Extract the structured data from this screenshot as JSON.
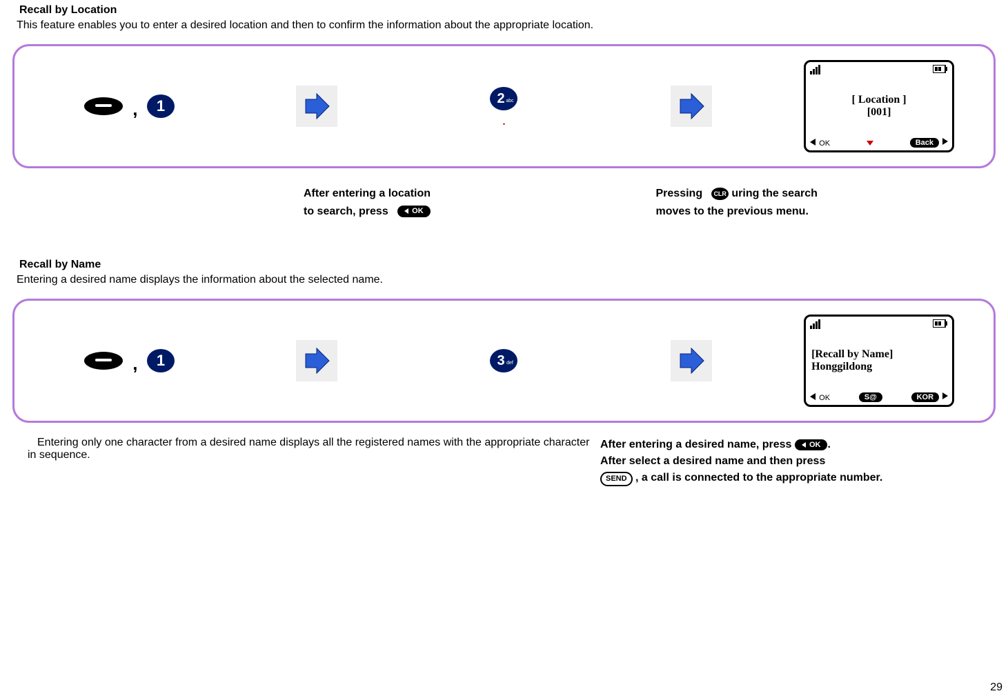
{
  "page_number": "29",
  "section1": {
    "title": "Recall by Location",
    "desc": "This feature enables you to enter a desired location and then to confirm the information about the appropriate location.",
    "key1_label": "1",
    "key2_label": "2",
    "key2_sub": "abc",
    "dot": ".",
    "screen": {
      "title": "[ Location ]",
      "value": "[001]",
      "ok": "OK",
      "back": "Back"
    },
    "note_left_a": "After entering a location",
    "note_left_b": "to search, press",
    "note_ok": "OK",
    "note_right_a": "Pressing",
    "note_right_clr": "CLR",
    "note_right_b": "uring the search",
    "note_right_c": "moves to the previous menu."
  },
  "section2": {
    "title": "Recall by Name",
    "desc": "Entering a desired name displays the information about the selected name.",
    "key1_label": "1",
    "key3_label": "3",
    "key3_sub": "def",
    "screen": {
      "title": "[Recall by Name]",
      "value": "Honggildong",
      "ok": "OK",
      "mid": "S@",
      "kor": "KOR"
    },
    "tip_left": "Entering only one character from a desired name displays all the registered names with the appropriate character in sequence.",
    "tip_right_a": "After entering a desired name, press",
    "tip_right_ok": "OK",
    "tip_right_b": "After select a desired name and then press",
    "tip_right_send": "SEND",
    "tip_right_c": ", a call is connected to the appropriate number."
  }
}
